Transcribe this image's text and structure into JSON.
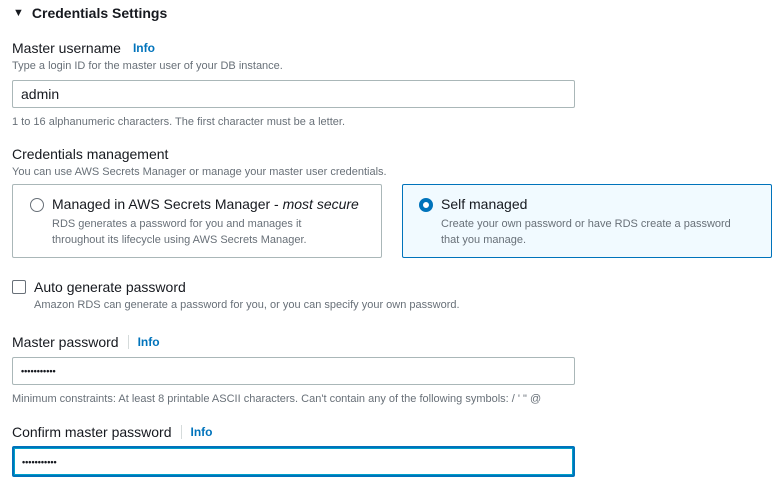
{
  "section": {
    "title": "Credentials Settings"
  },
  "master_username": {
    "label": "Master username",
    "info": "Info",
    "description": "Type a login ID for the master user of your DB instance.",
    "value": "admin",
    "constraint": "1 to 16 alphanumeric characters. The first character must be a letter."
  },
  "credentials_management": {
    "label": "Credentials management",
    "description": "You can use AWS Secrets Manager or manage your master user credentials.",
    "options": [
      {
        "title": "Managed in AWS Secrets Manager - ",
        "title_emphasis": "most secure",
        "desc_line1": "RDS generates a password for you and manages it",
        "desc_line2": "throughout its lifecycle using AWS Secrets Manager.",
        "selected": false
      },
      {
        "title": "Self managed",
        "desc_line1": "Create your own password or have RDS create a password",
        "desc_line2": "that you manage.",
        "selected": true
      }
    ]
  },
  "auto_generate": {
    "label": "Auto generate password",
    "description": "Amazon RDS can generate a password for you, or you can specify your own password.",
    "checked": false
  },
  "master_password": {
    "label": "Master password",
    "info": "Info",
    "value": "•••••••••••",
    "constraint": "Minimum constraints: At least 8 printable ASCII characters. Can't contain any of the following symbols: / ' \" @"
  },
  "confirm_password": {
    "label": "Confirm master password",
    "info": "Info",
    "value": "•••••••••••"
  },
  "colors": {
    "accent": "#0073bb",
    "muted": "#687078",
    "border": "#aab7b8"
  }
}
